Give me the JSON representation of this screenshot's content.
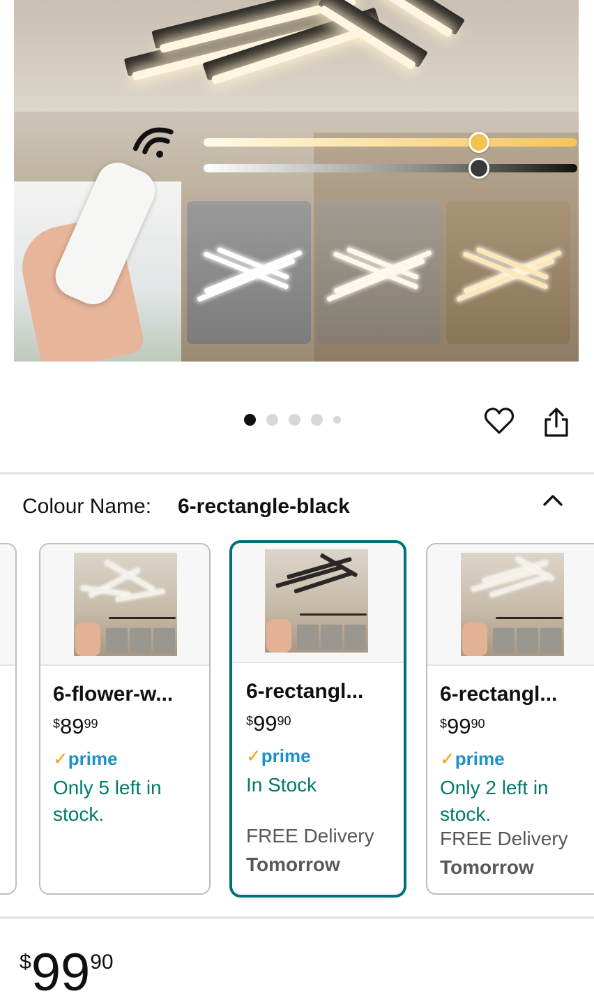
{
  "gallery": {
    "page_count": 5,
    "active_page": 0
  },
  "actions": {
    "wishlist_icon": "heart-icon",
    "share_icon": "share-icon"
  },
  "variation": {
    "label": "Colour Name:",
    "selected_value": "6-rectangle-black",
    "collapse_icon": "chevron-up-icon"
  },
  "options": [
    {
      "name": "6-flower-w...",
      "price_symbol": "$",
      "price_whole": "89",
      "price_cents": "99",
      "prime_check": "✓",
      "prime_label": "prime",
      "stock": "Only 5 left in stock.",
      "delivery": "",
      "delivery_day": "",
      "selected": false
    },
    {
      "name": "6-rectangl...",
      "price_symbol": "$",
      "price_whole": "99",
      "price_cents": "90",
      "prime_check": "✓",
      "prime_label": "prime",
      "stock": "In Stock",
      "delivery": "FREE Delivery",
      "delivery_day": "Tomorrow",
      "selected": true
    },
    {
      "name": "6-rectangl...",
      "price_symbol": "$",
      "price_whole": "99",
      "price_cents": "90",
      "prime_check": "✓",
      "prime_label": "prime",
      "stock": "Only 2 left in stock.",
      "delivery": "FREE Delivery",
      "delivery_day": "Tomorrow",
      "selected": false
    }
  ],
  "buybox": {
    "price_symbol": "$",
    "price_whole": "99",
    "price_cents": "90"
  },
  "colors": {
    "selected_border": "#00707a",
    "stock_green": "#007a6b",
    "prime_blue": "#1e90c8",
    "prime_check_orange": "#f0a31a"
  }
}
